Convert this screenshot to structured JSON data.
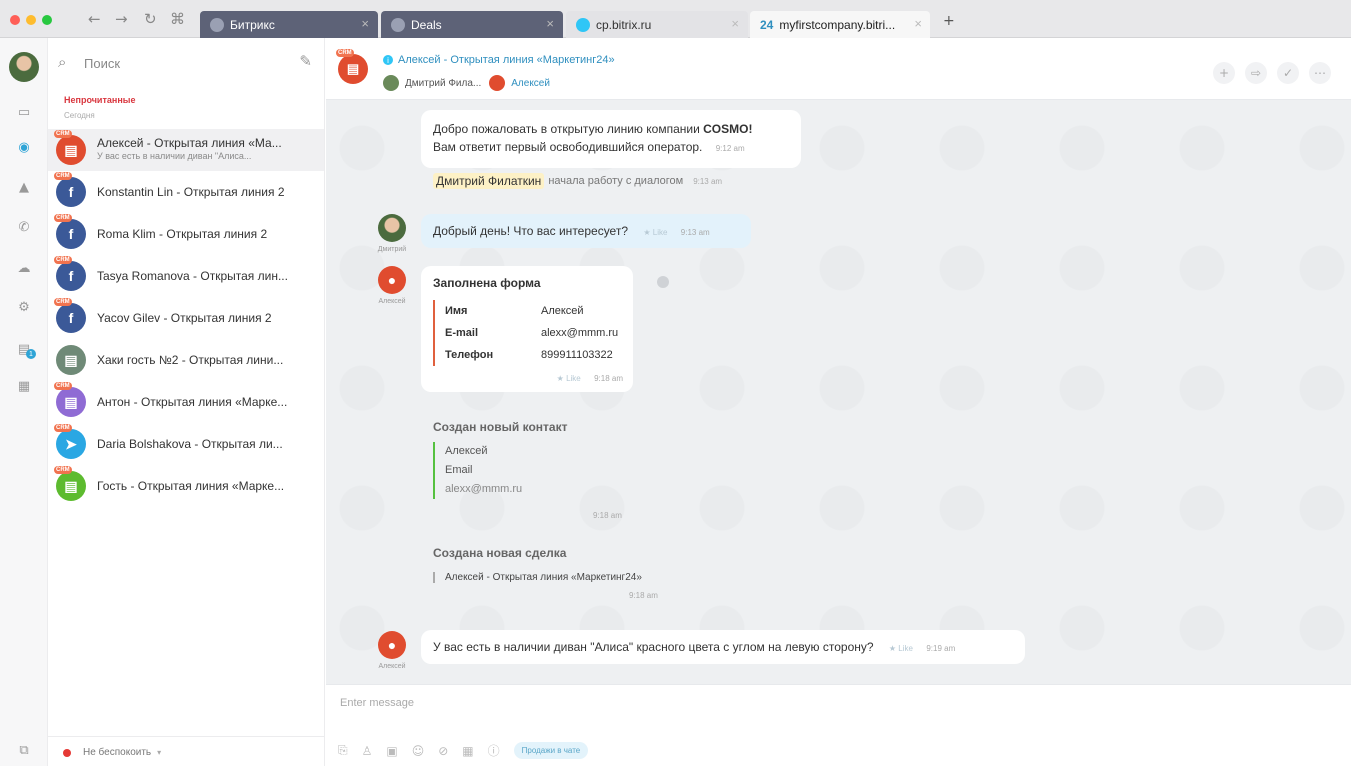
{
  "browser": {
    "tabs": [
      {
        "label": "Битрикс",
        "style": "dark"
      },
      {
        "label": "Deals",
        "style": "dark"
      },
      {
        "label": "cp.bitrix.ru",
        "style": "light"
      },
      {
        "label": "myfirstcompany.bitri...",
        "style": "active",
        "favicon_text": "24"
      }
    ],
    "new_tab": "+",
    "colors": {
      "tab_dark": "#5d6277",
      "traffic_red": "#ff5f57",
      "traffic_yellow": "#febc2e",
      "traffic_green": "#28c840"
    }
  },
  "recent": {
    "search_placeholder": "Поиск",
    "section_unread": "Непрочитанные",
    "section_today": "Сегодня",
    "items": [
      {
        "name": "Алексей - Открытая линия «Ма...",
        "preview": "У вас есть в наличии диван \"Алиса...",
        "avatar_color": "#e04c2f",
        "avatar_icon": "chat-icon",
        "badge": "CRM"
      },
      {
        "name": "Konstantin Lin - Открытая линия 2",
        "avatar_color": "#3b5998",
        "avatar_icon": "facebook-icon",
        "badge": "CRM"
      },
      {
        "name": "Roma Klim - Открытая линия 2",
        "avatar_color": "#3b5998",
        "avatar_icon": "facebook-icon",
        "badge": "CRM"
      },
      {
        "name": "Tasya Romanova - Открытая лин...",
        "avatar_color": "#3b5998",
        "avatar_icon": "facebook-icon",
        "badge": "CRM"
      },
      {
        "name": "Yacov Gilev - Открытая линия 2",
        "avatar_color": "#3b5998",
        "avatar_icon": "facebook-icon",
        "badge": "CRM"
      },
      {
        "name": "Хаки гость №2 - Открытая лини...",
        "avatar_color": "#6f8a77",
        "avatar_icon": "chat-icon",
        "badge": ""
      },
      {
        "name": "Антон - Открытая линия «Марке...",
        "avatar_color": "#8f6bd4",
        "avatar_icon": "chat-icon",
        "badge": "CRM"
      },
      {
        "name": "Daria Bolshakova - Открытая ли...",
        "avatar_color": "#2aa7e3",
        "avatar_icon": "telegram-icon",
        "badge": "CRM"
      },
      {
        "name": "Гость - Открытая линия «Марке...",
        "avatar_color": "#5dbb2f",
        "avatar_icon": "chat-icon",
        "badge": "CRM"
      }
    ],
    "status": "Не беспокоить"
  },
  "chat": {
    "title": "Алексей - Открытая линия «Маркетинг24»",
    "badge": "CRM",
    "participants": [
      {
        "name": "Дмитрий Фила...",
        "color": "#6a8a5a"
      },
      {
        "name": "Алексей",
        "color": "#e04c2f"
      }
    ],
    "header_actions": [
      "+",
      "⇨",
      "✓",
      "⋯"
    ],
    "messages": {
      "welcome_line1": "Добро пожаловать в открытую линию компании ",
      "welcome_brand": "COSMO!",
      "welcome_line2": "Вам ответит первый освободившийся оператор.",
      "welcome_time": "9:12 am",
      "sys_who": "Дмитрий Филаткин",
      "sys_text": "начала работу с диалогом",
      "sys_time": "9:13 am",
      "op_text": "Добрый день! Что вас интересует?",
      "op_like": "Like",
      "op_time": "9:13 am",
      "op_avatar_label": "Дмитрий",
      "form_title": "Заполнена форма",
      "form_fields": [
        {
          "k": "Имя",
          "v": "Алексей"
        },
        {
          "k": "E-mail",
          "v": "alexx@mmm.ru"
        },
        {
          "k": "Телефон",
          "v": "899911103322"
        }
      ],
      "form_like": "Like",
      "form_time": "9:18 am",
      "client_avatar_label": "Алексей",
      "contact_title": "Создан новый контакт",
      "contact_name": "Алексей",
      "contact_email_label": "Email",
      "contact_email": "alexx@mmm.ru",
      "contact_time": "9:18 am",
      "deal_title": "Создана новая сделка",
      "deal_name": "Алексей - Открытая линия «Маркетинг24»",
      "deal_time": "9:18 am",
      "question": "У вас есть в наличии диван \"Алиса\" красного цвета с углом на левую сторону?",
      "question_like": "Like",
      "question_time": "9:19 am"
    },
    "input_placeholder": "Enter message",
    "continue_label": "Продажи в чате"
  }
}
